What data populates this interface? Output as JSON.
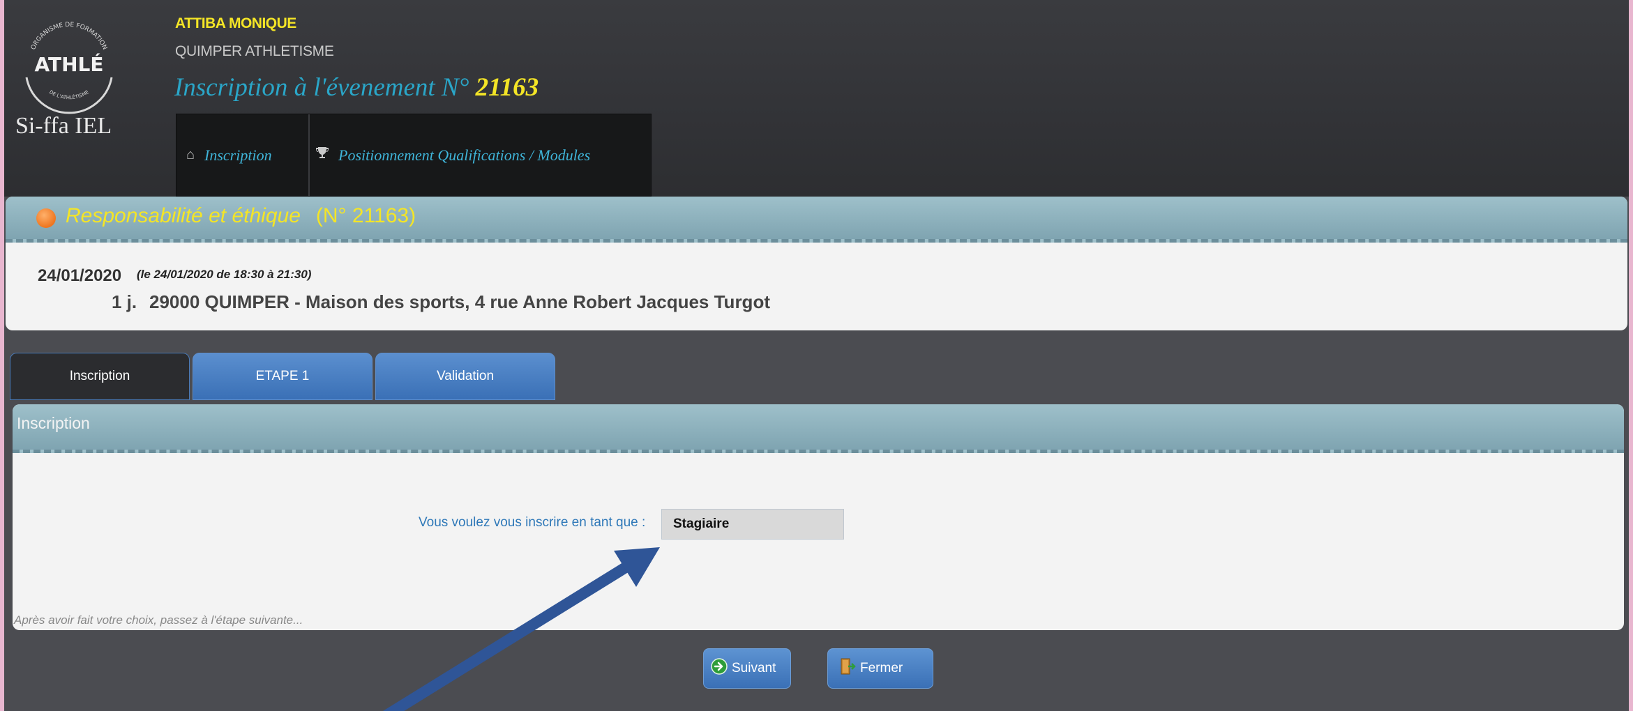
{
  "header": {
    "user_name": "ATTIBA MONIQUE",
    "club_name": "QUIMPER ATHLETISME",
    "event_title_prefix": "Inscription à l'évenement N°",
    "event_number": "21163",
    "logo_text": "Si-ffa IEL",
    "logo_ring_top": "ORGANISME DE FORMATION",
    "logo_ring_bottom": "DE L'ATHLÉTISME",
    "logo_word": "ATHLÉ"
  },
  "nav": {
    "items": [
      {
        "label": "Inscription",
        "icon": "home-icon"
      },
      {
        "label": "Positionnement Qualifications / Modules",
        "icon": "trophy-icon"
      }
    ]
  },
  "event_panel": {
    "title": "Responsabilité et éthique",
    "number_label": "(N° 21163)",
    "date": "24/01/2020",
    "hours": "(le 24/01/2020 de 18:30 à 21:30)",
    "duration": "1 j.",
    "location": "29000 QUIMPER - Maison des sports, 4 rue Anne Robert Jacques Turgot"
  },
  "tabs": [
    {
      "label": "Inscription",
      "active": true
    },
    {
      "label": "ETAPE 1",
      "active": false
    },
    {
      "label": "Validation",
      "active": false
    }
  ],
  "form_panel": {
    "title": "Inscription",
    "role_label": "Vous voulez vous inscrire en tant que :",
    "role_value": "Stagiaire",
    "hint": "Après avoir fait votre choix, passez à l'étape suivante..."
  },
  "buttons": {
    "next_label": "Suivant",
    "close_label": "Fermer"
  },
  "colors": {
    "accent_yellow": "#f4e526",
    "accent_blue": "#2aa6c8",
    "tab_blue": "#3a70b6",
    "annotation_arrow": "#2f5597"
  }
}
